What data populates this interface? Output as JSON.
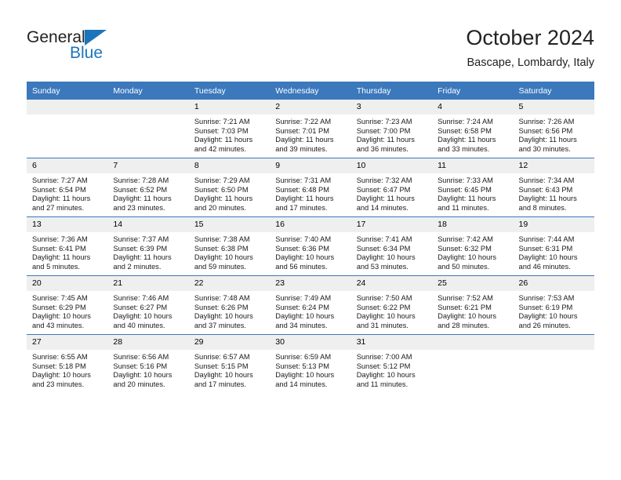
{
  "brand": {
    "word_one": "General",
    "word_two": "Blue",
    "triangle_icon": "triangle-icon",
    "accent_color": "#1b75bb"
  },
  "header": {
    "title": "October 2024",
    "location": "Bascape, Lombardy, Italy"
  },
  "calendar": {
    "header_bg": "#3b78bc",
    "daynum_bg": "#efefef",
    "weekdays": [
      "Sunday",
      "Monday",
      "Tuesday",
      "Wednesday",
      "Thursday",
      "Friday",
      "Saturday"
    ],
    "weeks": [
      [
        {
          "day": "",
          "empty": true,
          "sunrise": "",
          "sunset": "",
          "daylight_line1": "",
          "daylight_line2": ""
        },
        {
          "day": "",
          "empty": true,
          "sunrise": "",
          "sunset": "",
          "daylight_line1": "",
          "daylight_line2": ""
        },
        {
          "day": "1",
          "sunrise": "Sunrise: 7:21 AM",
          "sunset": "Sunset: 7:03 PM",
          "daylight_line1": "Daylight: 11 hours",
          "daylight_line2": "and 42 minutes."
        },
        {
          "day": "2",
          "sunrise": "Sunrise: 7:22 AM",
          "sunset": "Sunset: 7:01 PM",
          "daylight_line1": "Daylight: 11 hours",
          "daylight_line2": "and 39 minutes."
        },
        {
          "day": "3",
          "sunrise": "Sunrise: 7:23 AM",
          "sunset": "Sunset: 7:00 PM",
          "daylight_line1": "Daylight: 11 hours",
          "daylight_line2": "and 36 minutes."
        },
        {
          "day": "4",
          "sunrise": "Sunrise: 7:24 AM",
          "sunset": "Sunset: 6:58 PM",
          "daylight_line1": "Daylight: 11 hours",
          "daylight_line2": "and 33 minutes."
        },
        {
          "day": "5",
          "sunrise": "Sunrise: 7:26 AM",
          "sunset": "Sunset: 6:56 PM",
          "daylight_line1": "Daylight: 11 hours",
          "daylight_line2": "and 30 minutes."
        }
      ],
      [
        {
          "day": "6",
          "sunrise": "Sunrise: 7:27 AM",
          "sunset": "Sunset: 6:54 PM",
          "daylight_line1": "Daylight: 11 hours",
          "daylight_line2": "and 27 minutes."
        },
        {
          "day": "7",
          "sunrise": "Sunrise: 7:28 AM",
          "sunset": "Sunset: 6:52 PM",
          "daylight_line1": "Daylight: 11 hours",
          "daylight_line2": "and 23 minutes."
        },
        {
          "day": "8",
          "sunrise": "Sunrise: 7:29 AM",
          "sunset": "Sunset: 6:50 PM",
          "daylight_line1": "Daylight: 11 hours",
          "daylight_line2": "and 20 minutes."
        },
        {
          "day": "9",
          "sunrise": "Sunrise: 7:31 AM",
          "sunset": "Sunset: 6:48 PM",
          "daylight_line1": "Daylight: 11 hours",
          "daylight_line2": "and 17 minutes."
        },
        {
          "day": "10",
          "sunrise": "Sunrise: 7:32 AM",
          "sunset": "Sunset: 6:47 PM",
          "daylight_line1": "Daylight: 11 hours",
          "daylight_line2": "and 14 minutes."
        },
        {
          "day": "11",
          "sunrise": "Sunrise: 7:33 AM",
          "sunset": "Sunset: 6:45 PM",
          "daylight_line1": "Daylight: 11 hours",
          "daylight_line2": "and 11 minutes."
        },
        {
          "day": "12",
          "sunrise": "Sunrise: 7:34 AM",
          "sunset": "Sunset: 6:43 PM",
          "daylight_line1": "Daylight: 11 hours",
          "daylight_line2": "and 8 minutes."
        }
      ],
      [
        {
          "day": "13",
          "sunrise": "Sunrise: 7:36 AM",
          "sunset": "Sunset: 6:41 PM",
          "daylight_line1": "Daylight: 11 hours",
          "daylight_line2": "and 5 minutes."
        },
        {
          "day": "14",
          "sunrise": "Sunrise: 7:37 AM",
          "sunset": "Sunset: 6:39 PM",
          "daylight_line1": "Daylight: 11 hours",
          "daylight_line2": "and 2 minutes."
        },
        {
          "day": "15",
          "sunrise": "Sunrise: 7:38 AM",
          "sunset": "Sunset: 6:38 PM",
          "daylight_line1": "Daylight: 10 hours",
          "daylight_line2": "and 59 minutes."
        },
        {
          "day": "16",
          "sunrise": "Sunrise: 7:40 AM",
          "sunset": "Sunset: 6:36 PM",
          "daylight_line1": "Daylight: 10 hours",
          "daylight_line2": "and 56 minutes."
        },
        {
          "day": "17",
          "sunrise": "Sunrise: 7:41 AM",
          "sunset": "Sunset: 6:34 PM",
          "daylight_line1": "Daylight: 10 hours",
          "daylight_line2": "and 53 minutes."
        },
        {
          "day": "18",
          "sunrise": "Sunrise: 7:42 AM",
          "sunset": "Sunset: 6:32 PM",
          "daylight_line1": "Daylight: 10 hours",
          "daylight_line2": "and 50 minutes."
        },
        {
          "day": "19",
          "sunrise": "Sunrise: 7:44 AM",
          "sunset": "Sunset: 6:31 PM",
          "daylight_line1": "Daylight: 10 hours",
          "daylight_line2": "and 46 minutes."
        }
      ],
      [
        {
          "day": "20",
          "sunrise": "Sunrise: 7:45 AM",
          "sunset": "Sunset: 6:29 PM",
          "daylight_line1": "Daylight: 10 hours",
          "daylight_line2": "and 43 minutes."
        },
        {
          "day": "21",
          "sunrise": "Sunrise: 7:46 AM",
          "sunset": "Sunset: 6:27 PM",
          "daylight_line1": "Daylight: 10 hours",
          "daylight_line2": "and 40 minutes."
        },
        {
          "day": "22",
          "sunrise": "Sunrise: 7:48 AM",
          "sunset": "Sunset: 6:26 PM",
          "daylight_line1": "Daylight: 10 hours",
          "daylight_line2": "and 37 minutes."
        },
        {
          "day": "23",
          "sunrise": "Sunrise: 7:49 AM",
          "sunset": "Sunset: 6:24 PM",
          "daylight_line1": "Daylight: 10 hours",
          "daylight_line2": "and 34 minutes."
        },
        {
          "day": "24",
          "sunrise": "Sunrise: 7:50 AM",
          "sunset": "Sunset: 6:22 PM",
          "daylight_line1": "Daylight: 10 hours",
          "daylight_line2": "and 31 minutes."
        },
        {
          "day": "25",
          "sunrise": "Sunrise: 7:52 AM",
          "sunset": "Sunset: 6:21 PM",
          "daylight_line1": "Daylight: 10 hours",
          "daylight_line2": "and 28 minutes."
        },
        {
          "day": "26",
          "sunrise": "Sunrise: 7:53 AM",
          "sunset": "Sunset: 6:19 PM",
          "daylight_line1": "Daylight: 10 hours",
          "daylight_line2": "and 26 minutes."
        }
      ],
      [
        {
          "day": "27",
          "sunrise": "Sunrise: 6:55 AM",
          "sunset": "Sunset: 5:18 PM",
          "daylight_line1": "Daylight: 10 hours",
          "daylight_line2": "and 23 minutes."
        },
        {
          "day": "28",
          "sunrise": "Sunrise: 6:56 AM",
          "sunset": "Sunset: 5:16 PM",
          "daylight_line1": "Daylight: 10 hours",
          "daylight_line2": "and 20 minutes."
        },
        {
          "day": "29",
          "sunrise": "Sunrise: 6:57 AM",
          "sunset": "Sunset: 5:15 PM",
          "daylight_line1": "Daylight: 10 hours",
          "daylight_line2": "and 17 minutes."
        },
        {
          "day": "30",
          "sunrise": "Sunrise: 6:59 AM",
          "sunset": "Sunset: 5:13 PM",
          "daylight_line1": "Daylight: 10 hours",
          "daylight_line2": "and 14 minutes."
        },
        {
          "day": "31",
          "sunrise": "Sunrise: 7:00 AM",
          "sunset": "Sunset: 5:12 PM",
          "daylight_line1": "Daylight: 10 hours",
          "daylight_line2": "and 11 minutes."
        },
        {
          "day": "",
          "empty": true,
          "sunrise": "",
          "sunset": "",
          "daylight_line1": "",
          "daylight_line2": ""
        },
        {
          "day": "",
          "empty": true,
          "sunrise": "",
          "sunset": "",
          "daylight_line1": "",
          "daylight_line2": ""
        }
      ]
    ]
  }
}
